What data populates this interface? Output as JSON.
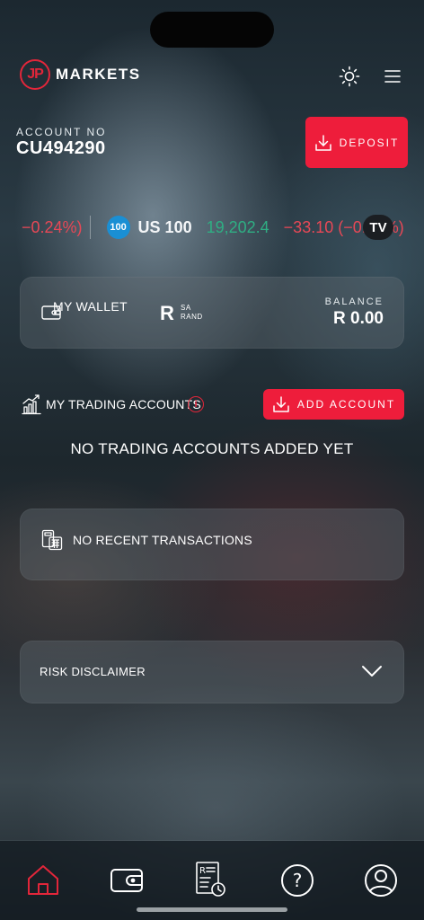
{
  "app": {
    "logo_badge": "JP",
    "logo_text": "MARKETS"
  },
  "account": {
    "label": "ACCOUNT NO",
    "number": "CU494290",
    "deposit_label": "DEPOSIT"
  },
  "ticker": {
    "prev_change": "−0.24%)",
    "badge": "100",
    "symbol": "US 100",
    "value": "19,202.4",
    "change": "−33.10 (−0.17%)",
    "provider_logo": "TV"
  },
  "wallet": {
    "label": "MY WALLET",
    "currency_symbol": "R",
    "currency_line1": "SA",
    "currency_line2": "RAND",
    "balance_label": "BALANCE",
    "balance_value": "R 0.00"
  },
  "trading_accounts": {
    "label": "MY TRADING ACCOUNTS",
    "info_glyph": "i",
    "add_label": "ADD ACCOUNT",
    "empty_message": "NO TRADING ACCOUNTS ADDED YET"
  },
  "transactions": {
    "empty_message": "NO RECENT TRANSACTIONS"
  },
  "risk": {
    "label": "RISK DISCLAIMER"
  },
  "nav": {
    "items": [
      "home-icon",
      "wallet-icon",
      "statement-icon",
      "help-icon",
      "profile-icon"
    ],
    "active": "home-icon"
  },
  "colors": {
    "accent_red": "#ee1d3b",
    "positive_green": "#2fae83",
    "negative_red": "#e84856"
  }
}
